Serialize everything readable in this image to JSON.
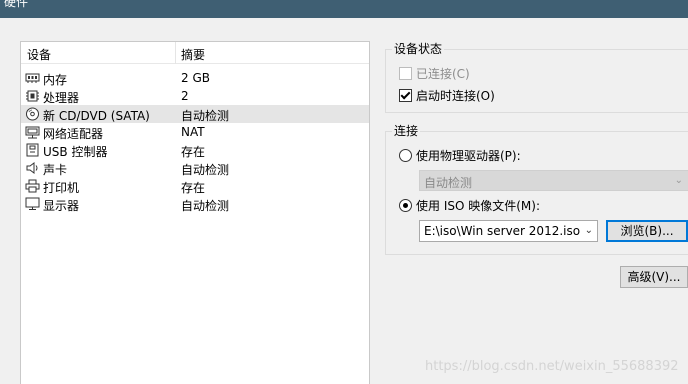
{
  "window": {
    "title": "硬件"
  },
  "device_list": {
    "columns": {
      "device": "设备",
      "summary": "摘要"
    },
    "rows": [
      {
        "name": "内存",
        "summary": "2 GB",
        "icon": "memory-icon"
      },
      {
        "name": "处理器",
        "summary": "2",
        "icon": "cpu-icon"
      },
      {
        "name": "新 CD/DVD (SATA)",
        "summary": "自动检测",
        "icon": "cd-dvd-icon",
        "selected": true
      },
      {
        "name": "网络适配器",
        "summary": "NAT",
        "icon": "network-icon"
      },
      {
        "name": "USB 控制器",
        "summary": "存在",
        "icon": "usb-icon"
      },
      {
        "name": "声卡",
        "summary": "自动检测",
        "icon": "speaker-icon"
      },
      {
        "name": "打印机",
        "summary": "存在",
        "icon": "printer-icon"
      },
      {
        "name": "显示器",
        "summary": "自动检测",
        "icon": "monitor-icon"
      }
    ]
  },
  "device_status": {
    "title": "设备状态",
    "connected_label": "已连接(C)",
    "connected_checked": false,
    "connect_on_power_label": "启动时连接(O)",
    "connect_on_power_checked": true
  },
  "connection": {
    "title": "连接",
    "physical_drive_label": "使用物理驱动器(P):",
    "physical_drive_value": "自动检测",
    "iso_label": "使用 ISO 映像文件(M):",
    "iso_value": "E:\\iso\\Win server 2012.iso",
    "browse_label": "浏览(B)..."
  },
  "advanced_label": "高级(V)...",
  "watermark": "https://blog.csdn.net/weixin_55688392"
}
